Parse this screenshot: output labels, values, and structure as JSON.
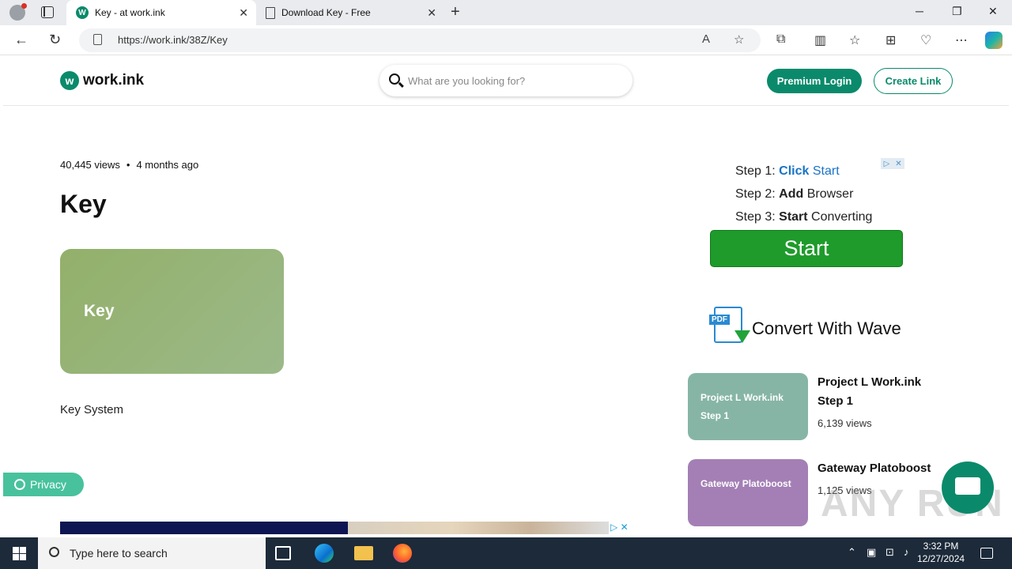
{
  "browser": {
    "tabs": [
      {
        "title": "Key - at work.ink",
        "favicon": "W"
      },
      {
        "title": "Download Key - Free"
      }
    ],
    "new_tab": "+",
    "window_controls": {
      "minimize": "─",
      "maximize": "❐",
      "close": "✕"
    },
    "url": "https://work.ink/38Z/Key"
  },
  "site": {
    "logo_mark": "w",
    "logo_text": "work.ink",
    "search_placeholder": "What are you looking for?",
    "premium_login": "Premium Login",
    "create_link": "Create Link",
    "accent_color": "#0a8a6b"
  },
  "content": {
    "views": "40,445 views",
    "separator": "•",
    "age": "4 months ago",
    "title": "Key",
    "card_label": "Key",
    "description": "Key System"
  },
  "privacy_label": "Privacy",
  "ad": {
    "step1": {
      "prefix": "Step 1: ",
      "bold": "Click",
      "rest": " Start"
    },
    "step2": {
      "prefix": "Step 2: ",
      "bold": "Add",
      "rest": " Browser"
    },
    "step3": {
      "prefix": "Step 3: ",
      "bold": "Start",
      "rest": " Converting"
    },
    "start_button": "Start",
    "wave_pdf_label": "PDF",
    "wave_text": "Convert With Wave"
  },
  "related": [
    {
      "thumb_text": "Project L Work.ink Step 1",
      "title": "Project L Work.ink Step 1",
      "views": "6,139 views",
      "color": "#86b5a6"
    },
    {
      "thumb_text": "Gateway Platoboost",
      "title": "Gateway Platoboost",
      "views": "1,125 views",
      "color": "#a47fb5"
    }
  ],
  "watermark": "ANY RUN",
  "taskbar": {
    "search_placeholder": "Type here to search",
    "time": "3:32 PM",
    "date": "12/27/2024"
  }
}
